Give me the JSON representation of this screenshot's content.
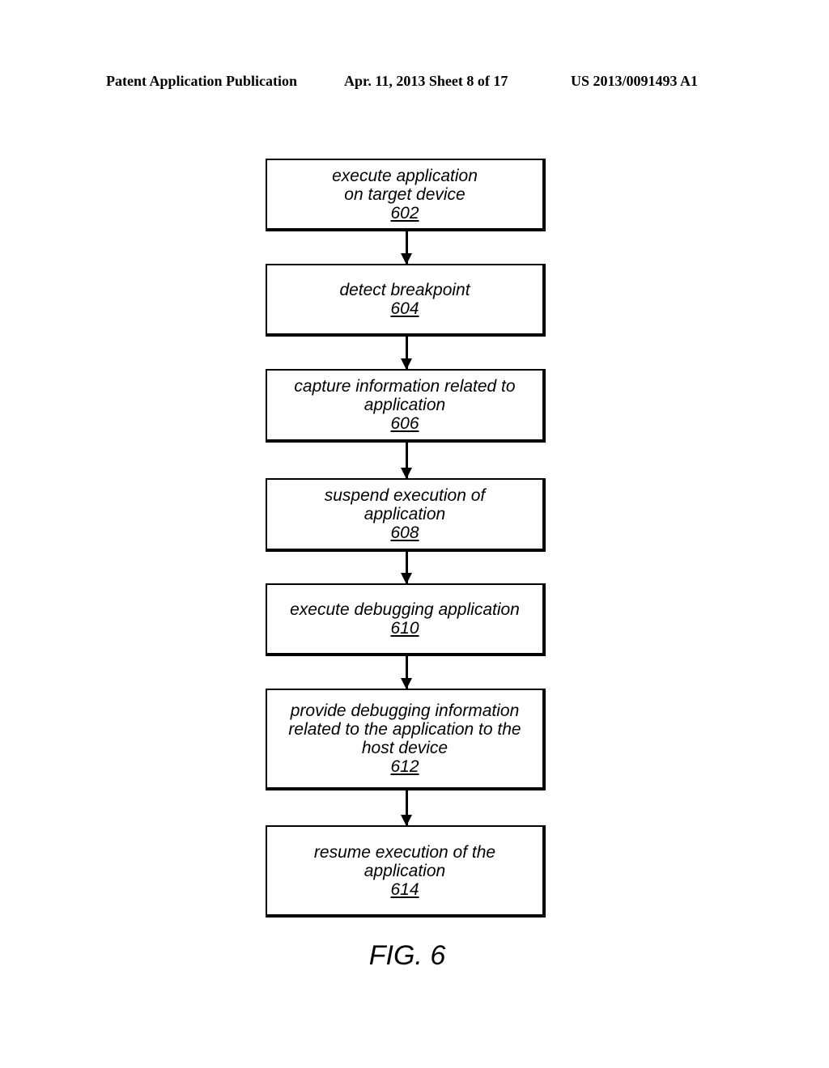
{
  "header": {
    "publication": "Patent Application Publication",
    "date_sheet": "Apr. 11, 2013  Sheet 8 of 17",
    "number": "US 2013/0091493 A1"
  },
  "flowchart": {
    "steps": [
      {
        "lines": [
          "execute application",
          "on target device"
        ],
        "ref": "602"
      },
      {
        "lines": [
          "detect breakpoint"
        ],
        "ref": "604"
      },
      {
        "lines": [
          "capture information related to",
          "application"
        ],
        "ref": "606"
      },
      {
        "lines": [
          "suspend execution of",
          "application"
        ],
        "ref": "608"
      },
      {
        "lines": [
          "execute debugging application"
        ],
        "ref": "610"
      },
      {
        "lines": [
          "provide debugging information",
          "related to the application to the",
          "host device"
        ],
        "ref": "612"
      },
      {
        "lines": [
          "resume execution of the",
          "application"
        ],
        "ref": "614"
      }
    ]
  },
  "figure_label": "FIG. 6"
}
